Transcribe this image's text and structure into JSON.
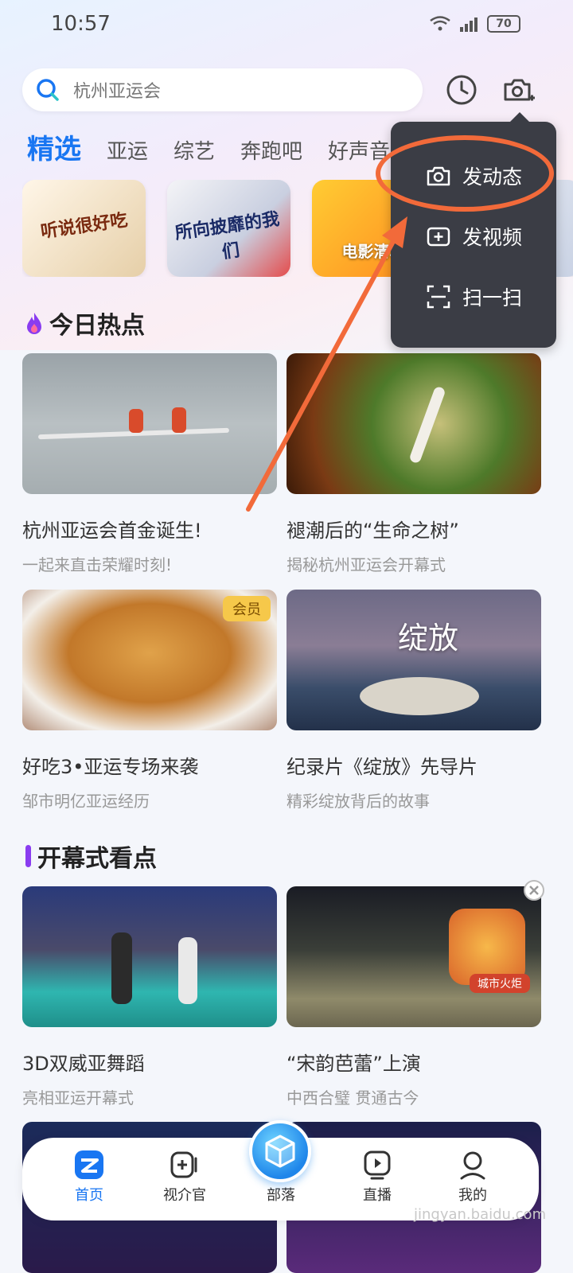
{
  "status_bar": {
    "time": "10:57",
    "battery": "70"
  },
  "search": {
    "placeholder": "杭州亚运会"
  },
  "tabs": [
    "精选",
    "亚运",
    "综艺",
    "奔跑吧",
    "好声音"
  ],
  "chips": [
    "听说很好吃",
    "所向披靡的我们",
    "电影清单"
  ],
  "section_hot": {
    "title": "今日热点"
  },
  "section_opening": {
    "title": "开幕式看点"
  },
  "cards": [
    {
      "title": "杭州亚运会首金诞生!",
      "subtitle": "一起来直击荣耀时刻!"
    },
    {
      "title": "褪潮后的“生命之树”",
      "subtitle": "揭秘杭州亚运会开幕式"
    },
    {
      "title": "好吃3•亚运专场来袭",
      "subtitle": "邹市明亿亚运经历",
      "badge": "会员"
    },
    {
      "title": "纪录片《绽放》先导片",
      "subtitle": "精彩绽放背后的故事",
      "image_text": "绽放"
    },
    {
      "title": "3D双威亚舞蹈",
      "subtitle": "亮相亚运开幕式"
    },
    {
      "title": "“宋韵芭蕾”上演",
      "subtitle": "中西合璧 贯通古今",
      "badge": "城市火炬"
    }
  ],
  "popup_menu": [
    "发动态",
    "发视频",
    "扫一扫"
  ],
  "bottom_nav": [
    "首页",
    "视介官",
    "部落",
    "直播",
    "我的"
  ],
  "watermark": "jingyan.baidu.com",
  "colors": {
    "accent": "#1976f2",
    "highlight": "#f26a3a",
    "popup_bg": "#3b3d45"
  }
}
